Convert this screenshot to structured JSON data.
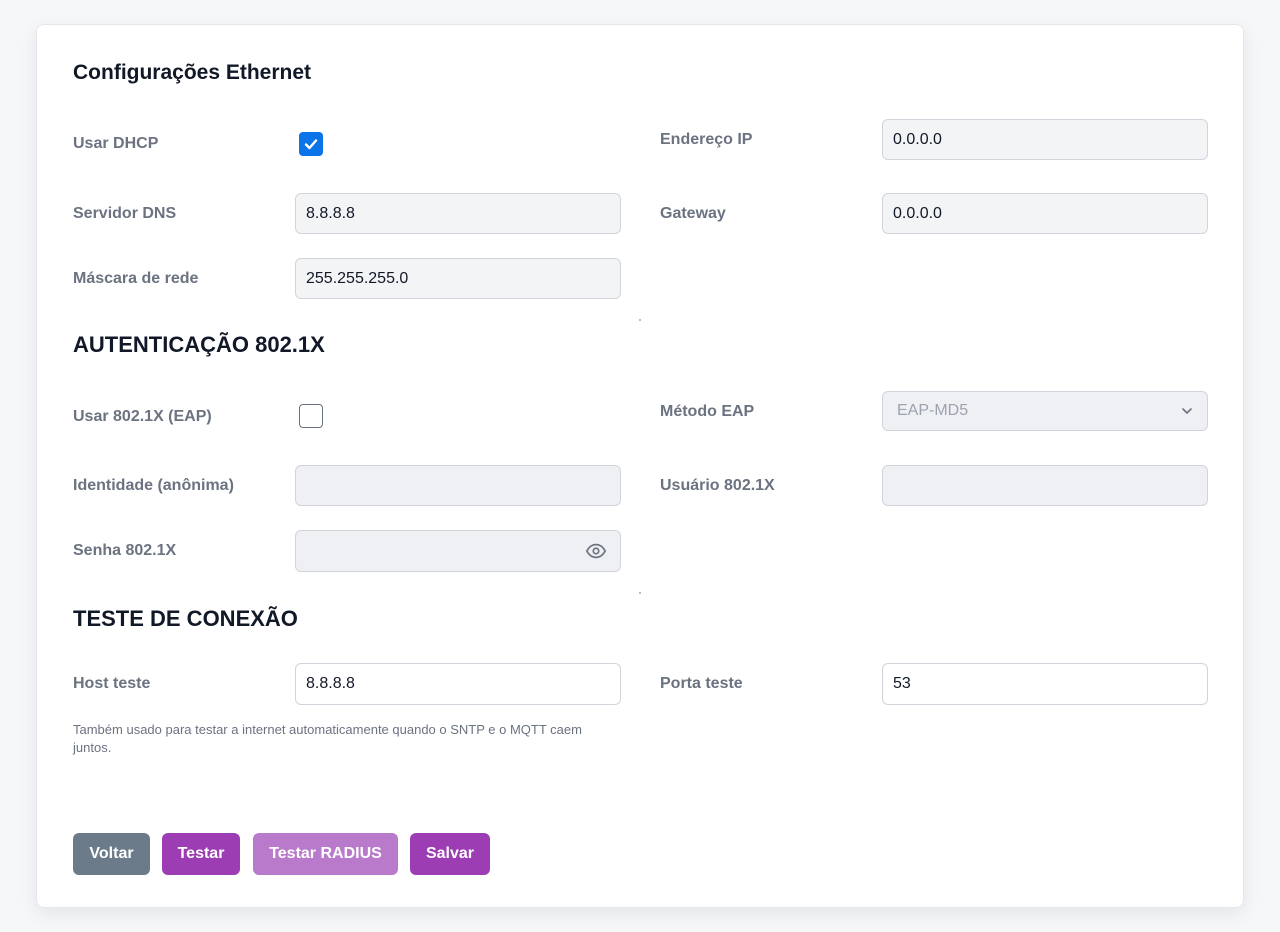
{
  "ethernet": {
    "title": "Configurações Ethernet",
    "dhcp_label": "Usar DHCP",
    "dhcp_checked": true,
    "ip_label": "Endereço IP",
    "ip_value": "0.0.0.0",
    "dns_label": "Servidor DNS",
    "dns_value": "8.8.8.8",
    "gateway_label": "Gateway",
    "gateway_value": "0.0.0.0",
    "mask_label": "Máscara de rede",
    "mask_value": "255.255.255.0"
  },
  "auth": {
    "title": "AUTENTICAÇÃO 802.1X",
    "eap_label": "Usar 802.1X (EAP)",
    "eap_checked": false,
    "method_label": "Método EAP",
    "method_value": "EAP-MD5",
    "identity_label": "Identidade (anônima)",
    "identity_value": "",
    "user_label": "Usuário 802.1X",
    "user_value": "",
    "password_label": "Senha 802.1X",
    "password_value": ""
  },
  "test": {
    "title": "TESTE DE CONEXÃO",
    "host_label": "Host teste",
    "host_value": "8.8.8.8",
    "port_label": "Porta teste",
    "port_value": "53",
    "help_text": "Também usado para testar a internet automaticamente quando o SNTP e o MQTT caem juntos."
  },
  "buttons": {
    "back": "Voltar",
    "test": "Testar",
    "test_radius": "Testar RADIUS",
    "save": "Salvar"
  },
  "icons": {
    "check": "check-icon",
    "eye": "eye-icon",
    "chevron": "chevron-down-icon"
  },
  "colors": {
    "accent": "#9c3db4",
    "checkbox": "#0a74e8",
    "back_button": "#6b7b89"
  }
}
